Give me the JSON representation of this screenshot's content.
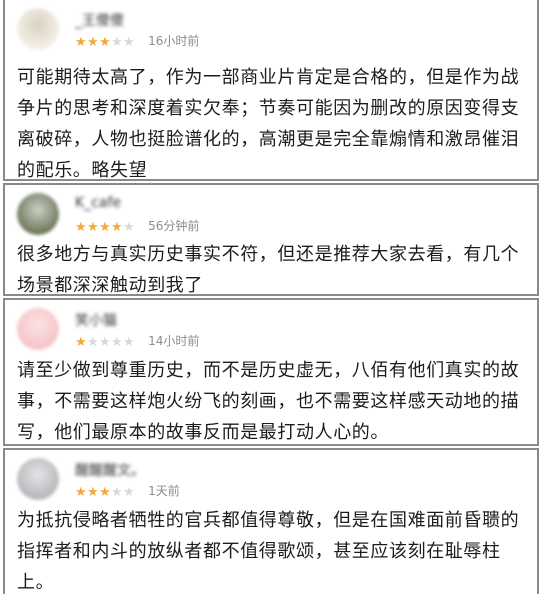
{
  "reviews": [
    {
      "username": "_王傻傻",
      "rating": 3,
      "time": "16小时前",
      "avatar_colors": [
        "#f4f0e6",
        "#d9d2c2"
      ],
      "text": "可能期待太高了，作为一部商业片肯定是合格的，但是作为战争片的思考和深度着实欠奉；节奏可能因为删改的原因变得支离破碎，人物也挺脸谱化的，高潮更是完全靠煽情和激昂催泪的配乐。略失望"
    },
    {
      "username": "K_cafe",
      "rating": 4,
      "time": "56分钟前",
      "avatar_colors": [
        "#6f7a5e",
        "#c9d0c3"
      ],
      "text": "很多地方与真实历史事实不符，但还是推荐大家去看，有几个场景都深深触动到我了"
    },
    {
      "username": "笑小猫",
      "rating": 1,
      "time": "14小时前",
      "avatar_colors": [
        "#f6c4c8",
        "#fbe3e5"
      ],
      "text": "请至少做到尊重历史，而不是历史虚无，八佰有他们真实的故事，不需要这样炮火纷飞的刻画，也不需要这样感天动地的描写，他们最原本的故事反而是最打动人心的。"
    },
    {
      "username": "醒醒醒文。",
      "rating": 3,
      "time": "1天前",
      "avatar_colors": [
        "#b8b8bc",
        "#e4e4e6"
      ],
      "text": "为抵抗侵略者牺牲的官兵都值得尊敬，但是在国难面前昏聩的指挥者和内斗的放纵者都不值得歌颂，甚至应该刻在耻辱柱上。"
    }
  ]
}
